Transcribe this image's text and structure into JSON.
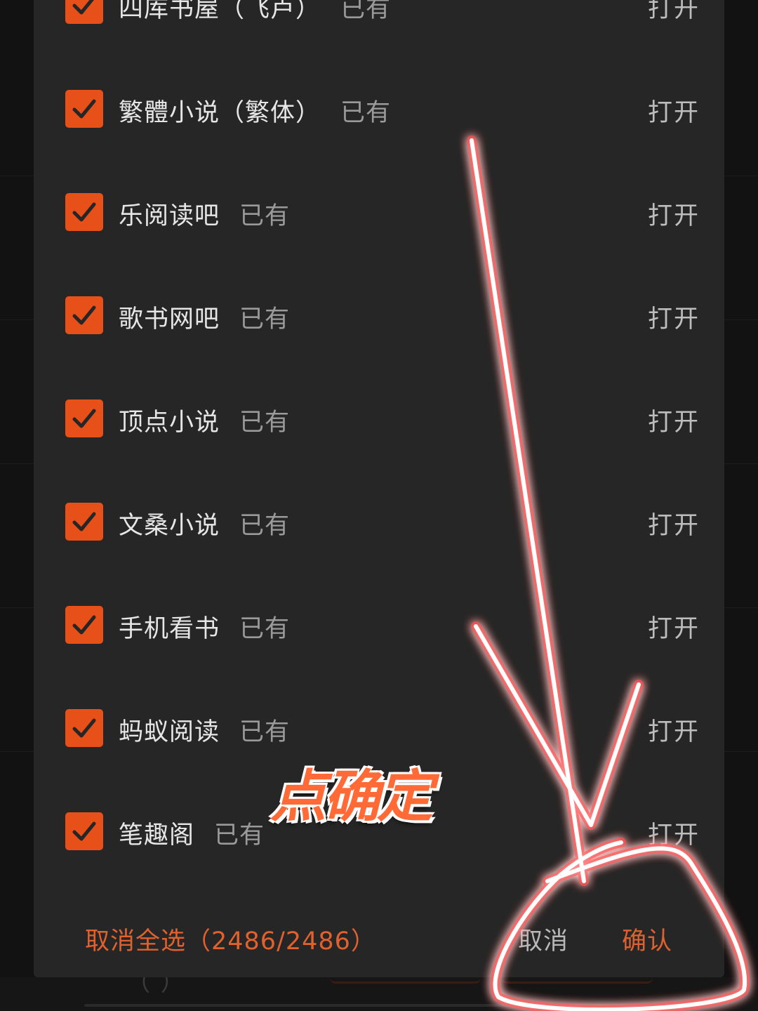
{
  "dialog": {
    "rows": [
      {
        "name": "四库书屋（飞卢）",
        "status": "已有",
        "action": "打开",
        "checked": true
      },
      {
        "name": "繁體小说（繁体）",
        "status": "已有",
        "action": "打开",
        "checked": true
      },
      {
        "name": "乐阅读吧",
        "status": "已有",
        "action": "打开",
        "checked": true
      },
      {
        "name": "歌书网吧",
        "status": "已有",
        "action": "打开",
        "checked": true
      },
      {
        "name": "顶点小说",
        "status": "已有",
        "action": "打开",
        "checked": true
      },
      {
        "name": "文桑小说",
        "status": "已有",
        "action": "打开",
        "checked": true
      },
      {
        "name": "手机看书",
        "status": "已有",
        "action": "打开",
        "checked": true
      },
      {
        "name": "蚂蚁阅读",
        "status": "已有",
        "action": "打开",
        "checked": true
      },
      {
        "name": "笔趣阁",
        "status": "已有",
        "action": "打开",
        "checked": true
      }
    ],
    "footer": {
      "deselect_label": "取消全选（2486/2486）",
      "cancel_label": "取消",
      "confirm_label": "确认"
    }
  },
  "annotation": {
    "text": "点确定",
    "color": "#ff6a36"
  },
  "colors": {
    "accent": "#e8501a",
    "dialog_bg": "#262626"
  }
}
